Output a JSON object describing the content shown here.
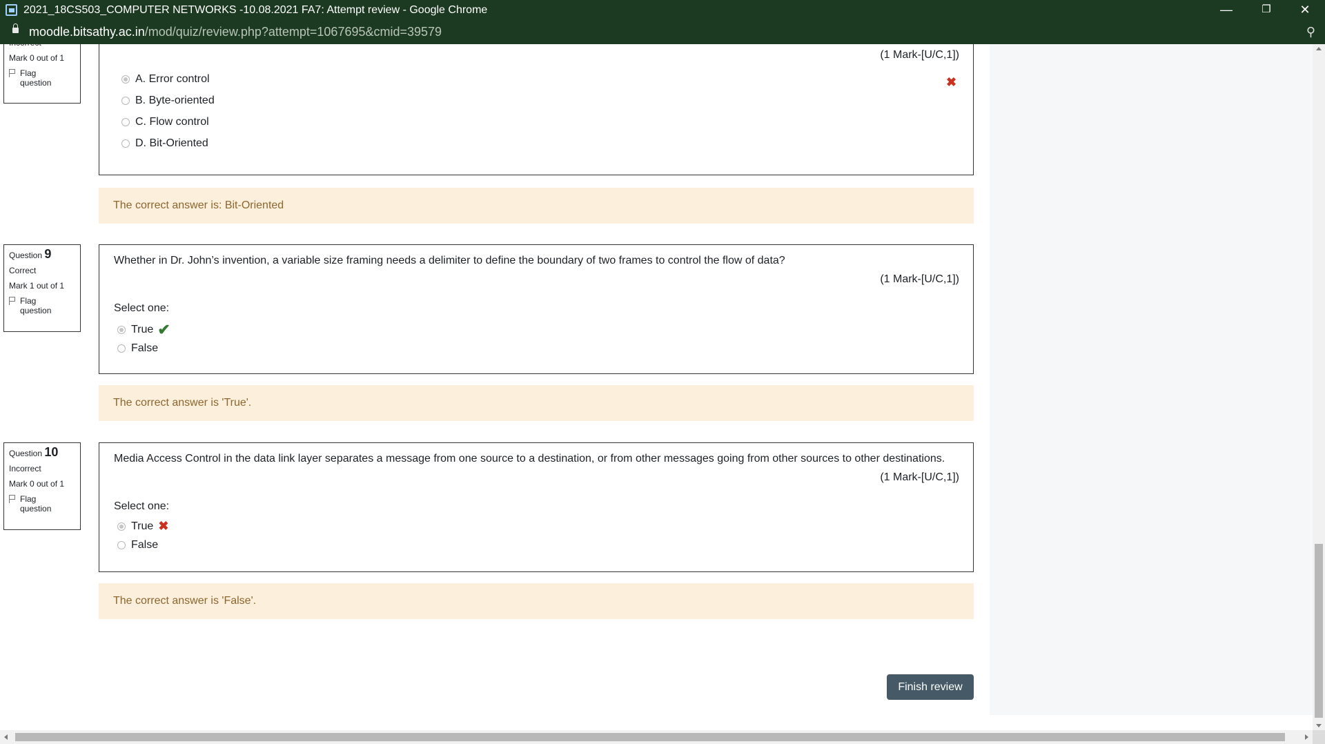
{
  "window": {
    "title": "2021_18CS503_COMPUTER NETWORKS -10.08.2021 FA7: Attempt review - Google Chrome",
    "minimize": "—",
    "restore": "❐",
    "close": "✕"
  },
  "address": {
    "domain": "moodle.bitsathy.ac.in",
    "path": "/mod/quiz/review.php?attempt=1067695&cmid=39579",
    "zoom_icon": "⚲"
  },
  "q8": {
    "state": "Incorrect",
    "grade": "Mark 0 out of 1",
    "flag": "Flag question",
    "mark": "(1 Mark-[U/C,1])",
    "options": [
      {
        "label": "A. Error control"
      },
      {
        "label": "B. Byte-oriented"
      },
      {
        "label": "C. Flow control"
      },
      {
        "label": "D. Bit-Oriented"
      }
    ],
    "result_icon": "✖",
    "feedback": "The correct answer is: Bit-Oriented"
  },
  "q9": {
    "prefix": "Question",
    "number": "9",
    "state": "Correct",
    "grade": "Mark 1 out of 1",
    "flag": "Flag question",
    "text": "Whether in Dr. John’s invention, a variable size framing needs a delimiter to define the boundary of two frames to control the flow of data?",
    "mark": "(1 Mark-[U/C,1])",
    "select_one": "Select one:",
    "opt_true": "True",
    "opt_false": "False",
    "result_icon": "✔",
    "feedback": "The correct answer is 'True'."
  },
  "q10": {
    "prefix": "Question",
    "number": "10",
    "state": "Incorrect",
    "grade": "Mark 0 out of 1",
    "flag": "Flag question",
    "text": "Media Access Control in the data link layer separates a message from one source to a destination, or from other messages going from other sources to other destinations.",
    "mark": "(1 Mark-[U/C,1])",
    "select_one": "Select one:",
    "opt_true": "True",
    "opt_false": "False",
    "result_icon": "✖",
    "feedback": "The correct answer is 'False'."
  },
  "finish_label": "Finish review",
  "colors": {
    "chrome_bar": "#1c3a22",
    "feedback_bg": "#fcefdc",
    "feedback_text": "#8e662e",
    "correct": "#357a32",
    "incorrect": "#ca3120",
    "finish_button": "#465966"
  }
}
